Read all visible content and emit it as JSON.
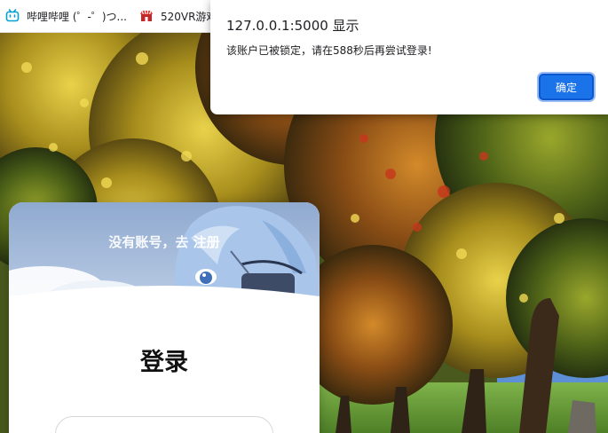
{
  "bookmarks": [
    {
      "label": "哔哩哔哩 (゜-゜)つ...",
      "icon": "bilibili-icon"
    },
    {
      "label": "520VR游戏",
      "icon": "vr-store-icon"
    }
  ],
  "dialog": {
    "title": "127.0.0.1:5000 显示",
    "message": "该账户已被锁定，请在588秒后再尝试登录!",
    "ok_label": "确定"
  },
  "login": {
    "prompt_text": "没有账号，去",
    "register_link": "注册",
    "title": "登录"
  },
  "colors": {
    "accent": "#1a73e8",
    "bilibili": "#00a1d6"
  }
}
